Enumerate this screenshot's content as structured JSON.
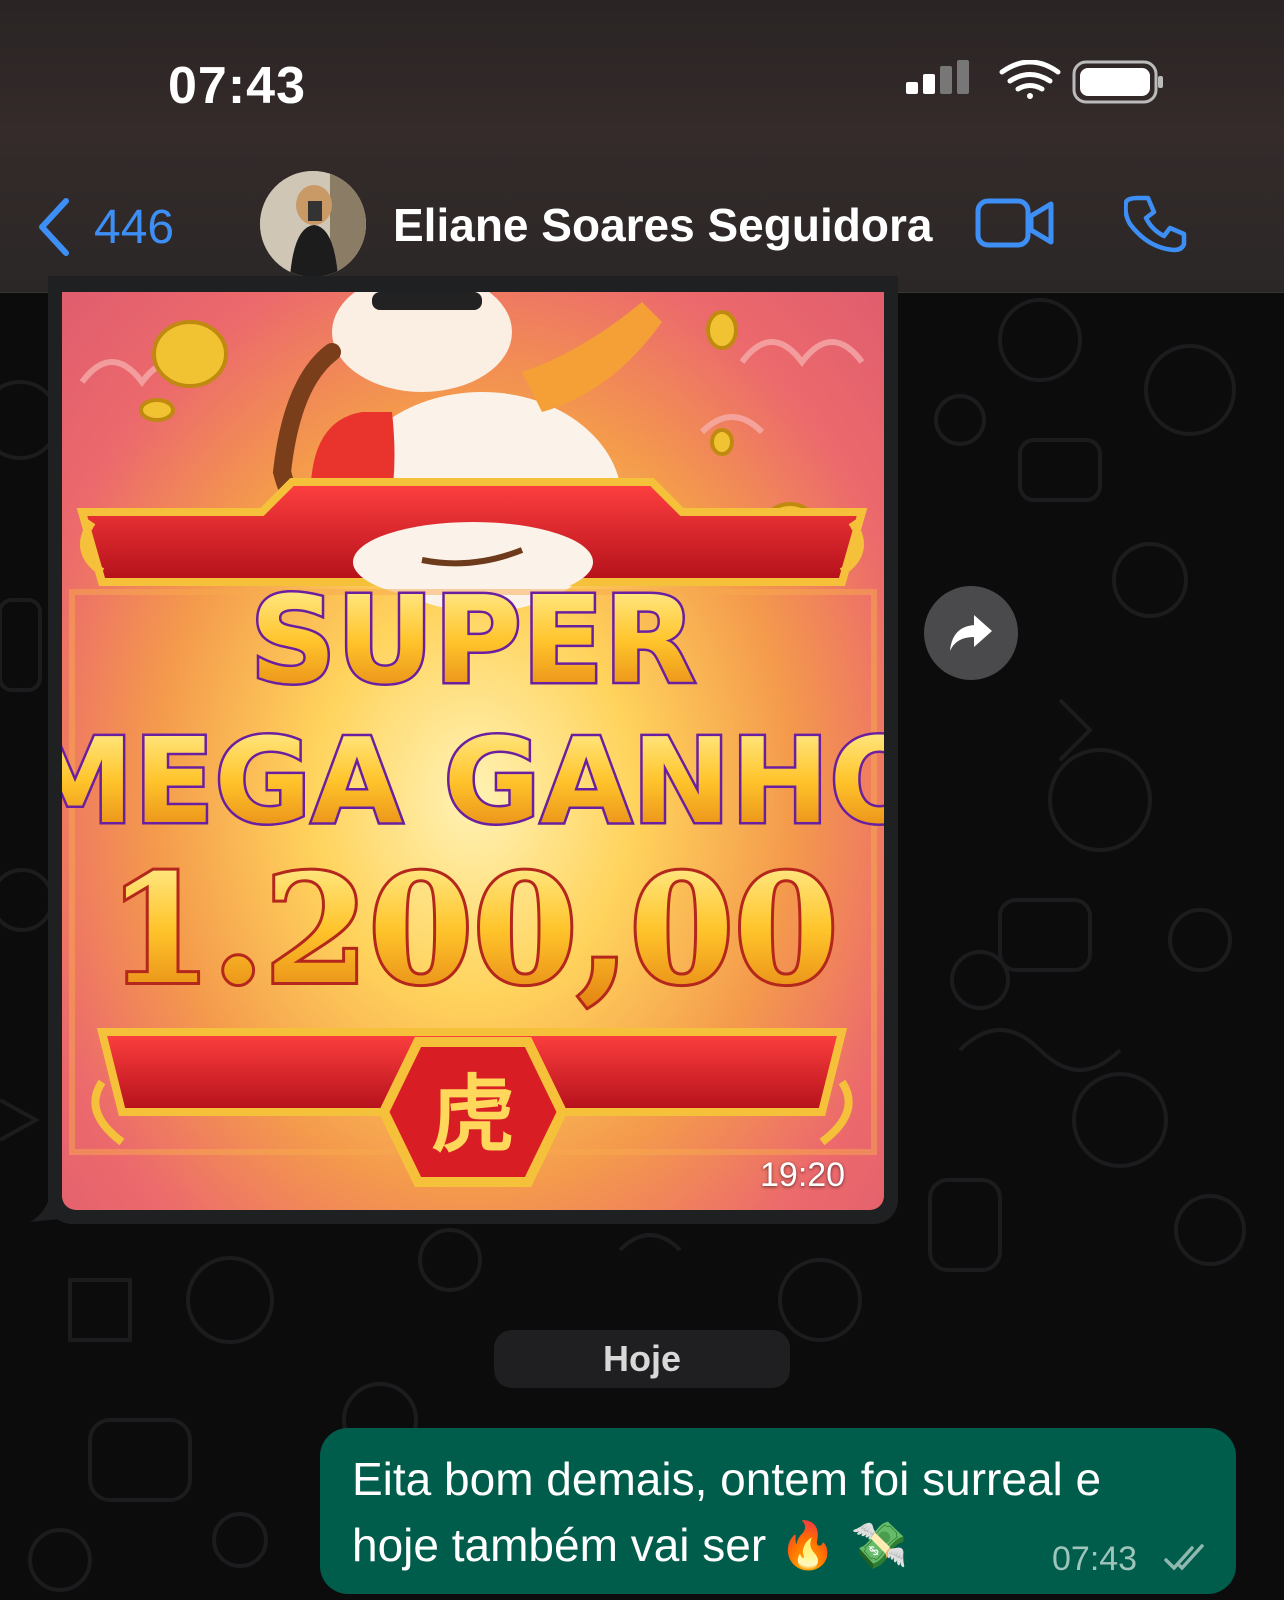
{
  "status_bar": {
    "time": "07:43",
    "icons": [
      "signal-icon",
      "wifi-icon",
      "battery-icon"
    ]
  },
  "nav": {
    "back_count": "446",
    "contact_name": "Eliane Soares Seguidora",
    "icons": [
      "chevron-left-icon",
      "video-call-icon",
      "phone-icon"
    ],
    "accent_color": "#3d8ff5"
  },
  "messages": {
    "image_message": {
      "text_lines": [
        "SUPER",
        "MEGA GANHO",
        "1.200,00"
      ],
      "seal_char": "虎",
      "time": "19:20"
    },
    "date_separator": "Hoje",
    "outgoing": {
      "text_line1": "Eita bom demais, ontem foi surreal e",
      "text_line2": "hoje também vai ser",
      "emojis": "🔥 💸",
      "time": "07:43",
      "bubble_color": "#005c4b"
    }
  }
}
